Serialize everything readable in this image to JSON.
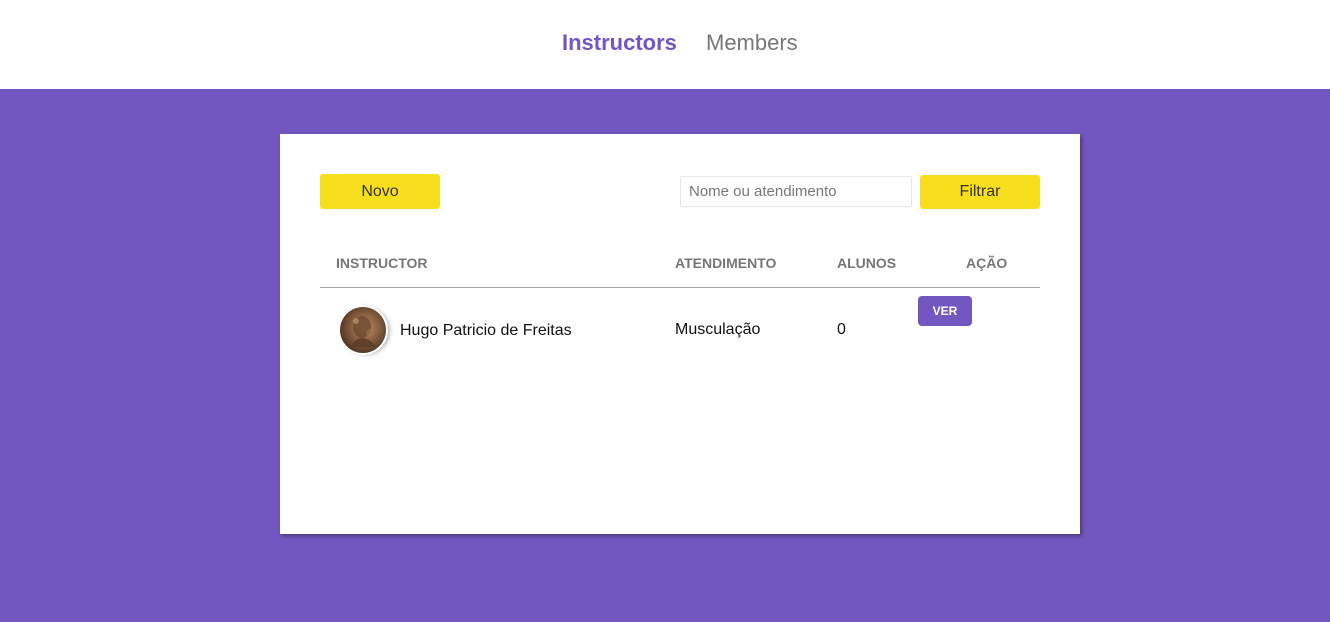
{
  "nav": {
    "instructors": "Instructors",
    "members": "Members",
    "active": "instructors"
  },
  "toolbar": {
    "new_label": "Novo",
    "search_placeholder": "Nome ou atendimento",
    "search_value": "",
    "filter_label": "Filtrar"
  },
  "table": {
    "headers": {
      "instructor": "Instructor",
      "service": "Atendimento",
      "students": "Alunos",
      "action": "Ação"
    },
    "rows": [
      {
        "name": "Hugo Patricio de Freitas",
        "service": "Musculação",
        "students": "0",
        "action_label": "ver"
      }
    ]
  },
  "colors": {
    "accent": "#7357c0",
    "button_yellow": "#f7df1e",
    "muted_text": "#777777"
  }
}
